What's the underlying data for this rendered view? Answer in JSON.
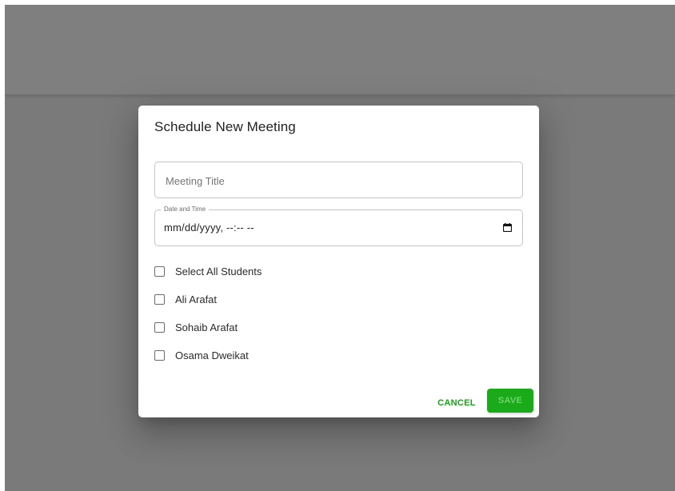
{
  "dialog": {
    "title": "Schedule New Meeting",
    "meeting_title": {
      "placeholder": "Meeting Title",
      "value": ""
    },
    "date_time": {
      "label": "Date and Time",
      "value": "mm/dd/yyyy, --:-- --",
      "icon": "calendar-icon"
    },
    "checkboxes": [
      {
        "label": "Select All Students",
        "checked": false
      },
      {
        "label": "Ali Arafat",
        "checked": false
      },
      {
        "label": "Sohaib Arafat",
        "checked": false
      },
      {
        "label": "Osama Dweikat",
        "checked": false
      }
    ],
    "actions": {
      "cancel_label": "CANCEL",
      "save_label": "SAVE"
    }
  },
  "colors": {
    "accent": "#1aaa1a",
    "overlay": "#7a7a7a"
  }
}
